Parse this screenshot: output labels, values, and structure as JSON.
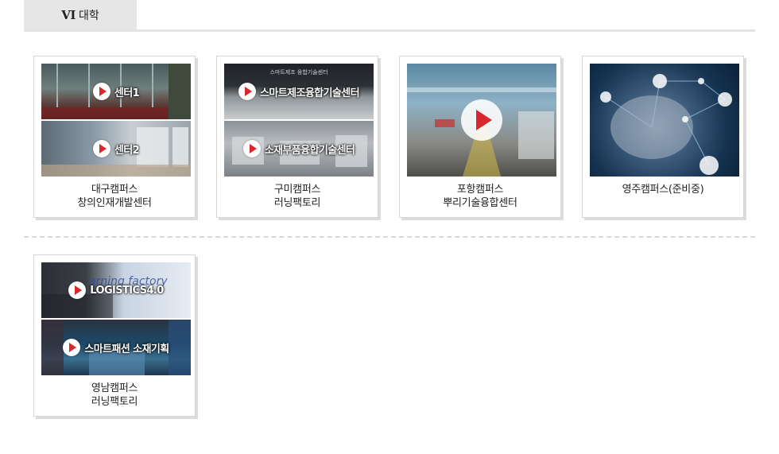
{
  "header": {
    "tab_brand": "VI",
    "tab_label": "대학"
  },
  "accent_color": "#d9272d",
  "cards": [
    {
      "caption": [
        "대구캠퍼스",
        "창의인재개발센터"
      ],
      "videos": [
        {
          "label": "센터1",
          "icon": "play-icon"
        },
        {
          "label": "센터2",
          "icon": "play-icon"
        }
      ]
    },
    {
      "caption": [
        "구미캠퍼스",
        "러닝팩토리"
      ],
      "sign_text": "스마트제조 융합기술센터",
      "videos": [
        {
          "label": "스마트제조융합기술센터",
          "icon": "play-icon"
        },
        {
          "label": "소재부품융합기술센터",
          "icon": "play-icon"
        }
      ]
    },
    {
      "caption": [
        "포항캠퍼스",
        "뿌리기술융합센터"
      ],
      "videos": [
        {
          "label": "",
          "icon": "play-icon"
        }
      ]
    },
    {
      "caption": [
        "영주캠퍼스(준비중)"
      ],
      "videos": []
    },
    {
      "caption": [
        "영남캠퍼스",
        "러닝팩토리"
      ],
      "videos": [
        {
          "label": "LOGISTICS4.0",
          "icon": "play-icon"
        },
        {
          "label": "스마트패션 소재기획",
          "icon": "play-icon"
        }
      ]
    }
  ]
}
